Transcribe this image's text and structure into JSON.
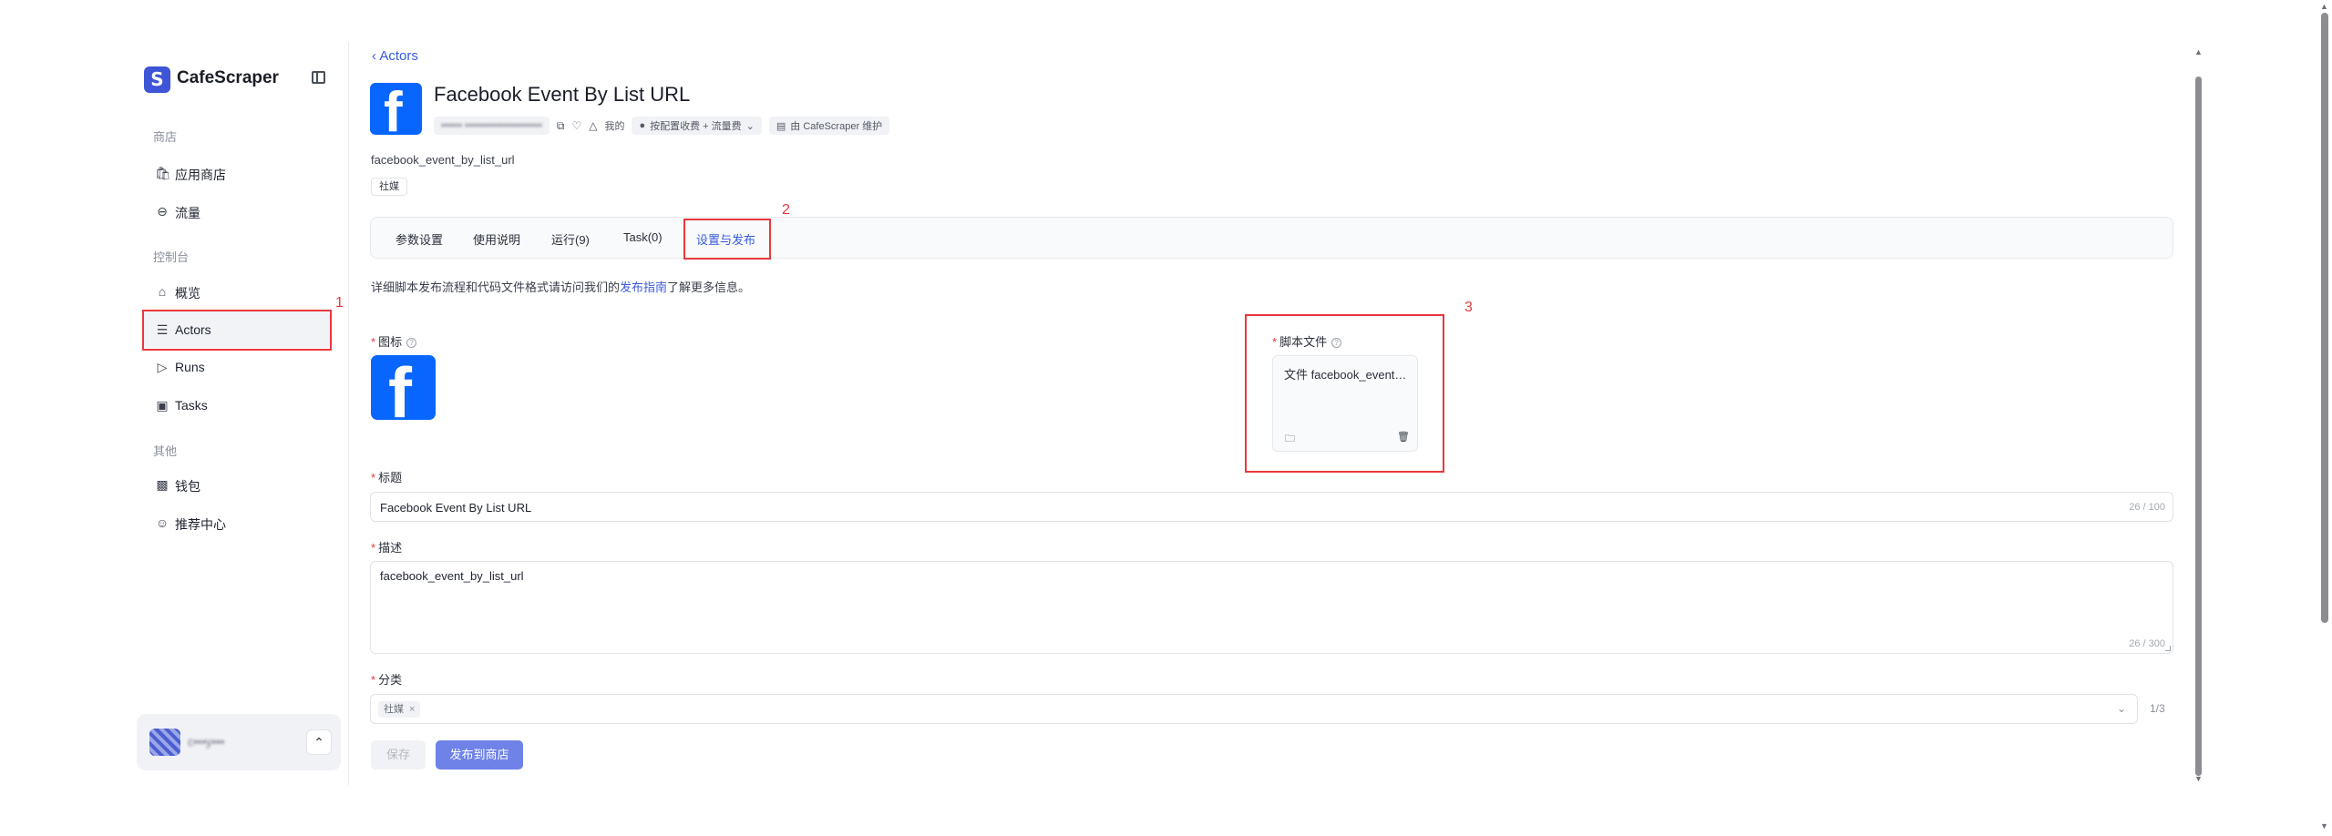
{
  "sidebar": {
    "logo_letter": "S",
    "brand": "CafeScraper",
    "sections": {
      "store": "商店",
      "console": "控制台",
      "other": "其他"
    },
    "items": [
      {
        "label": "应用商店",
        "icon": "store-icon"
      },
      {
        "label": "流量",
        "icon": "traffic-icon"
      },
      {
        "label": "概览",
        "icon": "home-icon"
      },
      {
        "label": "Actors",
        "icon": "layers-icon"
      },
      {
        "label": "Runs",
        "icon": "play-icon"
      },
      {
        "label": "Tasks",
        "icon": "calendar-icon"
      },
      {
        "label": "钱包",
        "icon": "wallet-icon"
      },
      {
        "label": "推荐中心",
        "icon": "user-plus-icon"
      }
    ],
    "user_name": "c•••y•••"
  },
  "header": {
    "back_label": "Actors",
    "fb_glyph": "f",
    "title": "Facebook Event By List URL",
    "id_text": "•••••• ••••••••••••••••••••••",
    "mine_label": "我的",
    "pricing_label": "按配置收费 + 流量费",
    "maintainer_label": "由 CafeScraper 维护",
    "slug": "facebook_event_by_list_url",
    "tag": "社媒"
  },
  "tabs": [
    {
      "label": "参数设置"
    },
    {
      "label": "使用说明"
    },
    {
      "label": "运行(9)"
    },
    {
      "label": "Task(0)"
    },
    {
      "label": "设置与发布"
    }
  ],
  "guide": {
    "prefix": "详细脚本发布流程和代码文件格式请访问我们的",
    "link": "发布指南",
    "suffix": "了解更多信息。"
  },
  "form": {
    "icon_label": "图标",
    "script_label": "脚本文件",
    "file_name": "文件 facebook_event_by_list_url.zip",
    "title_label": "标题",
    "title_value": "Facebook Event By List URL",
    "title_count": "26 / 100",
    "desc_label": "描述",
    "desc_value": "facebook_event_by_list_url",
    "desc_count": "26 / 300",
    "category_label": "分类",
    "category_chip": "社媒",
    "category_count": "1/3",
    "required_mark": "*",
    "help_mark": "?"
  },
  "actions": {
    "save": "保存",
    "publish": "发布到商店"
  },
  "annotations": [
    "1",
    "2",
    "3"
  ],
  "colors": {
    "accent": "#3b5bdb",
    "facebook": "#0866ff",
    "annotation_red": "#e8383d"
  }
}
